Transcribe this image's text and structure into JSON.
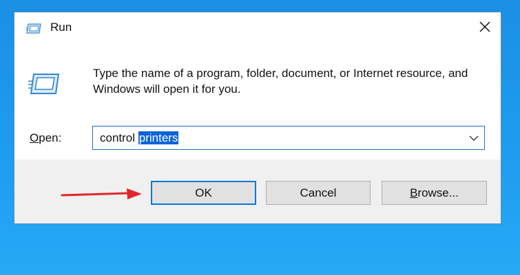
{
  "window": {
    "title": "Run",
    "close_icon": "close-icon",
    "app_icon": "run-icon"
  },
  "content": {
    "description": "Type the name of a program, folder, document, or Internet resource, and Windows will open it for you.",
    "open_label_accel": "O",
    "open_label_rest": "pen:",
    "input_value_prefix": "control ",
    "input_value_selected": "printers",
    "dropdown_icon": "chevron-down-icon"
  },
  "buttons": {
    "ok_label": "OK",
    "cancel_label": "Cancel",
    "browse_accel": "B",
    "browse_rest": "rowse..."
  },
  "annotation": {
    "arrow_icon": "red-arrow-icon",
    "arrow_color": "#e0262b"
  },
  "colors": {
    "desktop": "#1e9cf0",
    "accent": "#0078d7",
    "selection": "#0a64d8"
  }
}
